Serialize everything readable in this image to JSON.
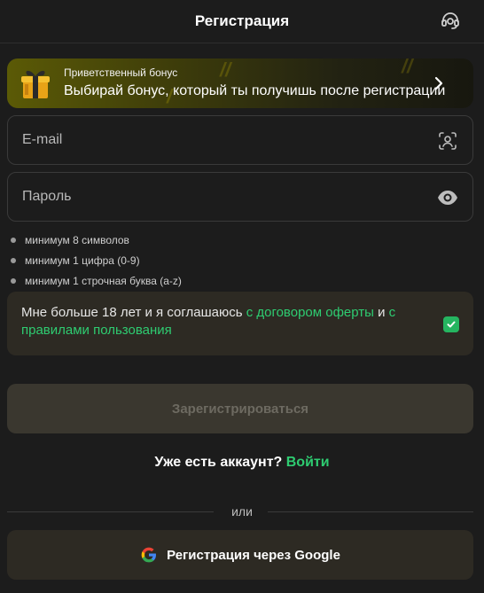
{
  "header": {
    "title": "Регистрация",
    "support_icon": "headset-icon"
  },
  "bonus": {
    "small_label": "Приветственный бонус",
    "main_label": "Выбирай бонус, который ты получишь после регистрации",
    "icon": "gift-icon",
    "chevron": "chevron-right-icon"
  },
  "form": {
    "email_placeholder": "E-mail",
    "email_icon": "face-scan-icon",
    "password_placeholder": "Пароль",
    "password_icon": "eye-icon"
  },
  "password_rules": [
    "минимум 8 символов",
    "минимум 1 цифра (0-9)",
    "минимум 1 строчная буква (a-z)"
  ],
  "agreement": {
    "text_start": "Мне больше 18 лет и я соглашаюсь ",
    "link_offer": "с договором оферты",
    "text_and": " и ",
    "link_rules": "с правилами пользования",
    "checked": true
  },
  "submit_label": "Зарегистрироваться",
  "login": {
    "prompt": "Уже есть аккаунт? ",
    "link": "Войти"
  },
  "or_label": "или",
  "google_label": "Регистрация через Google",
  "colors": {
    "background": "#1c1c1c",
    "accent_green": "#2ecc71",
    "panel": "#2d2a23",
    "disabled_button": "#3a372f"
  }
}
